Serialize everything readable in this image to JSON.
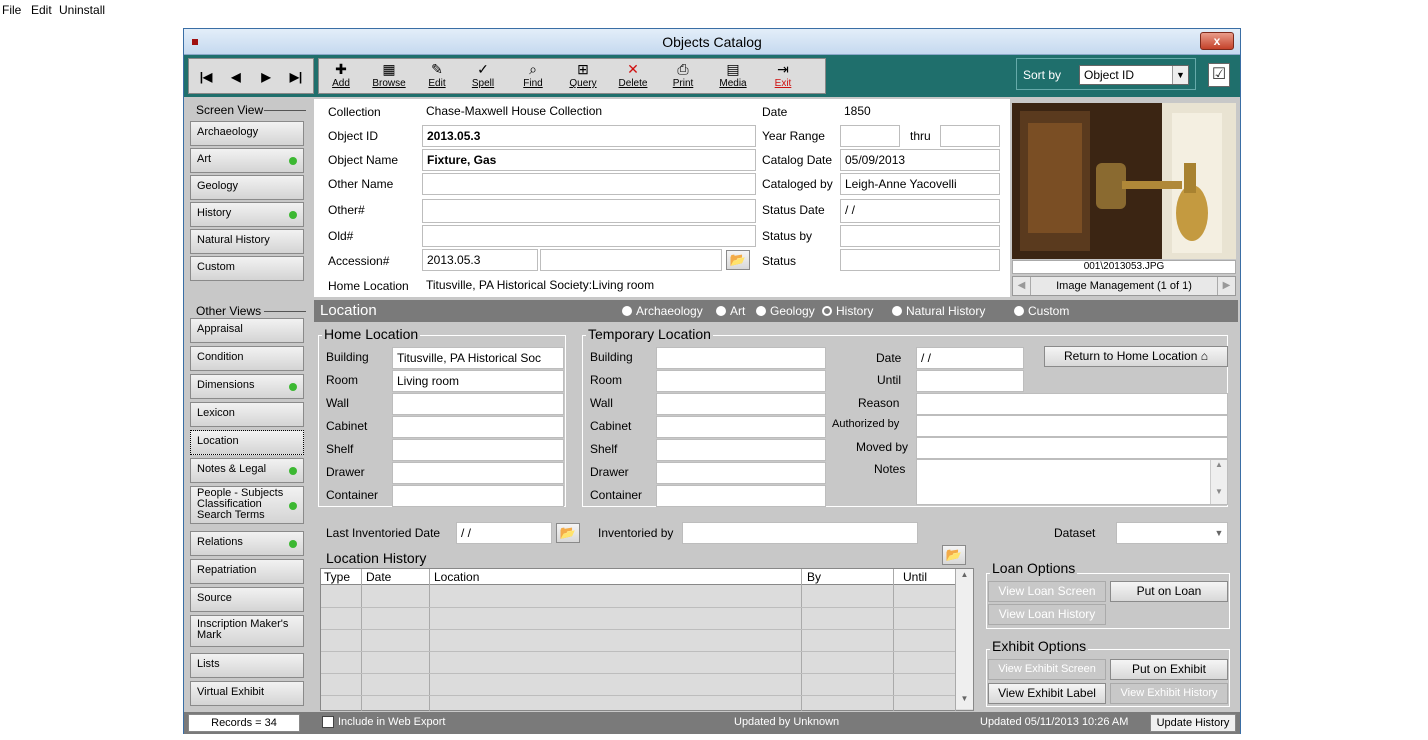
{
  "menu": [
    "File",
    "Edit",
    "Uninstall"
  ],
  "window": {
    "title": "Objects Catalog",
    "close": "x"
  },
  "toolbar": {
    "nav": [
      "|◀",
      "◀",
      "▶",
      "▶|"
    ],
    "buttons": [
      {
        "icon": "✚",
        "label": "Add"
      },
      {
        "icon": "▦",
        "label": "Browse"
      },
      {
        "icon": "✎",
        "label": "Edit"
      },
      {
        "icon": "✓",
        "label": "Spell"
      },
      {
        "icon": "⌕",
        "label": "Find"
      },
      {
        "icon": "⊞",
        "label": "Query"
      },
      {
        "icon": "✕",
        "label": "Delete"
      },
      {
        "icon": "⎙",
        "label": "Print"
      },
      {
        "icon": "▤",
        "label": "Media"
      },
      {
        "icon": "⇥",
        "label": "Exit"
      }
    ],
    "sort_label": "Sort by",
    "sort_value": "Object ID"
  },
  "sidebar": {
    "screen_view_title": "Screen View",
    "screen_view": [
      {
        "label": "Archaeology",
        "dot": false
      },
      {
        "label": "Art",
        "dot": true
      },
      {
        "label": "Geology",
        "dot": false
      },
      {
        "label": "History",
        "dot": true
      },
      {
        "label": "Natural History",
        "dot": false
      },
      {
        "label": "Custom",
        "dot": false
      }
    ],
    "other_views_title": "Other Views",
    "other_views": [
      {
        "label": "Appraisal",
        "dot": false
      },
      {
        "label": "Condition",
        "dot": false
      },
      {
        "label": "Dimensions",
        "dot": true
      },
      {
        "label": "Lexicon",
        "dot": false
      },
      {
        "label": "Location",
        "dot": false
      },
      {
        "label": "Notes & Legal",
        "dot": true
      },
      {
        "label": "People - Subjects Classification Search Terms",
        "dot": true
      },
      {
        "label": "Relations",
        "dot": true
      },
      {
        "label": "Repatriation",
        "dot": false
      },
      {
        "label": "Source",
        "dot": false
      },
      {
        "label": "Inscription Maker's Mark",
        "dot": false
      },
      {
        "label": "Lists",
        "dot": false
      },
      {
        "label": "Virtual Exhibit",
        "dot": false
      }
    ]
  },
  "record": {
    "collection_label": "Collection",
    "collection": "Chase-Maxwell House Collection",
    "object_id_label": "Object ID",
    "object_id": "2013.05.3",
    "object_name_label": "Object Name",
    "object_name": "Fixture, Gas",
    "other_name_label": "Other Name",
    "other_name": "",
    "other_num_label": "Other#",
    "other_num": "",
    "old_num_label": "Old#",
    "old_num": "",
    "accession_label": "Accession#",
    "accession": "2013.05.3",
    "home_location_label": "Home Location",
    "home_location": "Titusville, PA Historical Society:Living room",
    "date_label": "Date",
    "date": "1850",
    "year_range_label": "Year Range",
    "thru": "thru",
    "catalog_date_label": "Catalog Date",
    "catalog_date": "05/09/2013",
    "cataloged_by_label": "Cataloged by",
    "cataloged_by": "Leigh-Anne Yacovelli",
    "status_date_label": "Status Date",
    "status_date": " / /",
    "status_by_label": "Status by",
    "status_label": "Status"
  },
  "image": {
    "filename": "001\\2013053.JPG",
    "management": "Image Management (1 of 1)"
  },
  "location": {
    "title": "Location",
    "radios": [
      {
        "label": "Archaeology",
        "on": false
      },
      {
        "label": "Art",
        "on": false
      },
      {
        "label": "Geology",
        "on": false
      },
      {
        "label": "History",
        "on": true
      },
      {
        "label": "Natural History",
        "on": false
      },
      {
        "label": "Custom",
        "on": false
      }
    ],
    "home_title": "Home Location",
    "home_fields": [
      {
        "label": "Building",
        "value": "Titusville, PA Historical Soc"
      },
      {
        "label": "Room",
        "value": "Living room"
      },
      {
        "label": "Wall",
        "value": ""
      },
      {
        "label": "Cabinet",
        "value": ""
      },
      {
        "label": "Shelf",
        "value": ""
      },
      {
        "label": "Drawer",
        "value": ""
      },
      {
        "label": "Container",
        "value": ""
      }
    ],
    "temp_title": "Temporary Location",
    "temp_fields": [
      "Building",
      "Room",
      "Wall",
      "Cabinet",
      "Shelf",
      "Drawer",
      "Container"
    ],
    "temp_date_label": "Date",
    "temp_date": " / /",
    "until_label": "Until",
    "reason_label": "Reason",
    "authorized_label": "Authorized by",
    "moved_label": "Moved by",
    "notes_label": "Notes",
    "return_btn": "Return to Home Location",
    "last_inv_label": "Last Inventoried Date",
    "last_inv": " / /",
    "inv_by_label": "Inventoried by",
    "dataset_label": "Dataset",
    "history_title": "Location History",
    "history_cols": [
      "Type",
      "Date",
      "Location",
      "By",
      "Until"
    ]
  },
  "loan": {
    "title": "Loan Options",
    "view_screen": "View Loan Screen",
    "put": "Put on Loan",
    "view_history": "View Loan History"
  },
  "exhibit": {
    "title": "Exhibit Options",
    "view_screen": "View Exhibit Screen",
    "put": "Put on Exhibit",
    "view_label": "View Exhibit Label",
    "view_history": "View Exhibit History"
  },
  "status": {
    "records": "Records = 34",
    "web_export": "Include in Web Export",
    "updated_by": "Updated by  Unknown",
    "updated": "Updated  05/11/2013 10:26 AM",
    "update_history": "Update History"
  }
}
